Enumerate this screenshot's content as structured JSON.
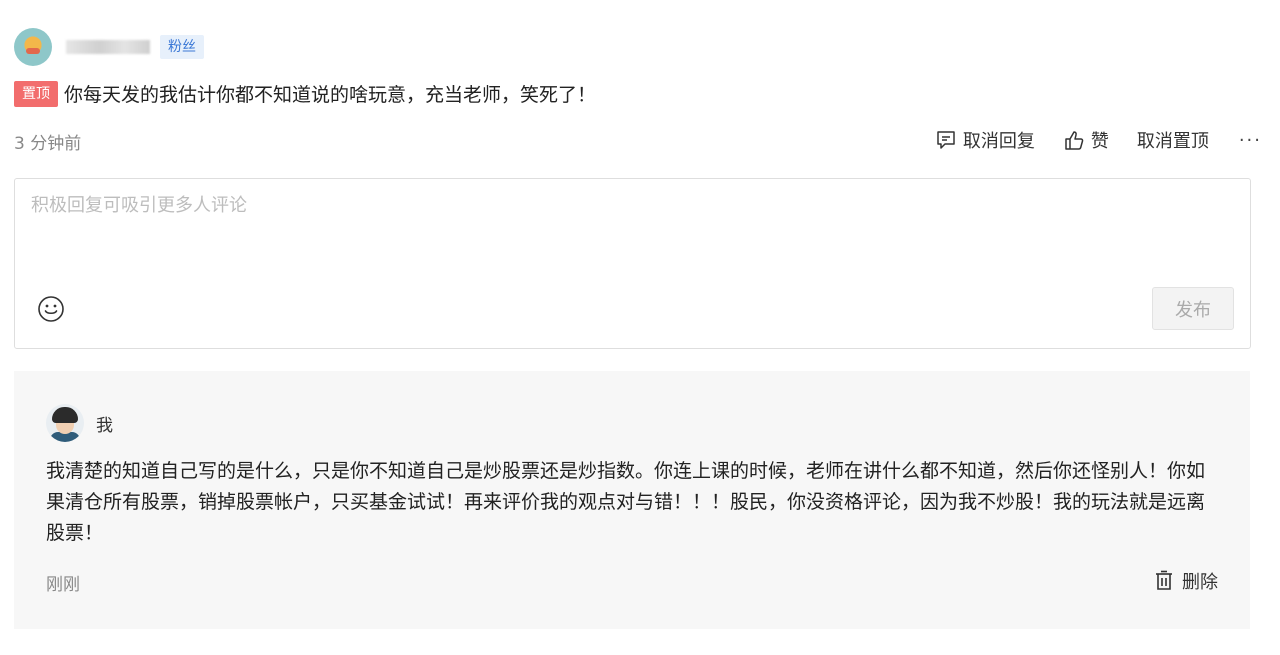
{
  "comment": {
    "user_badge": "粉丝",
    "pin_badge": "置顶",
    "text": "你每天发的我估计你都不知道说的啥玩意，充当老师，笑死了！",
    "time": "3 分钟前",
    "actions": {
      "cancel_reply": "取消回复",
      "like": "赞",
      "cancel_pin": "取消置顶",
      "more": "···"
    }
  },
  "reply_box": {
    "placeholder": "积极回复可吸引更多人评论",
    "value": "",
    "publish_label": "发布"
  },
  "sub_reply": {
    "author": "我",
    "text": "我清楚的知道自己写的是什么，只是你不知道自己是炒股票还是炒指数。你连上课的时候，老师在讲什么都不知道，然后你还怪别人！你如果清仓所有股票，销掉股票帐户，只买基金试试！再来评价我的观点对与错！！！股民，你没资格评论，因为我不炒股！我的玩法就是远离股票！",
    "time": "刚刚",
    "delete_label": "删除"
  },
  "icons": [
    "avatar",
    "comment-icon",
    "thumb-up-icon",
    "smile-icon",
    "trash-icon"
  ],
  "colors": {
    "pin_badge_bg": "#f26d6d",
    "fan_badge_bg": "#e7f0fb",
    "fan_badge_text": "#3b78d6",
    "sub_reply_bg": "#f7f7f7"
  }
}
